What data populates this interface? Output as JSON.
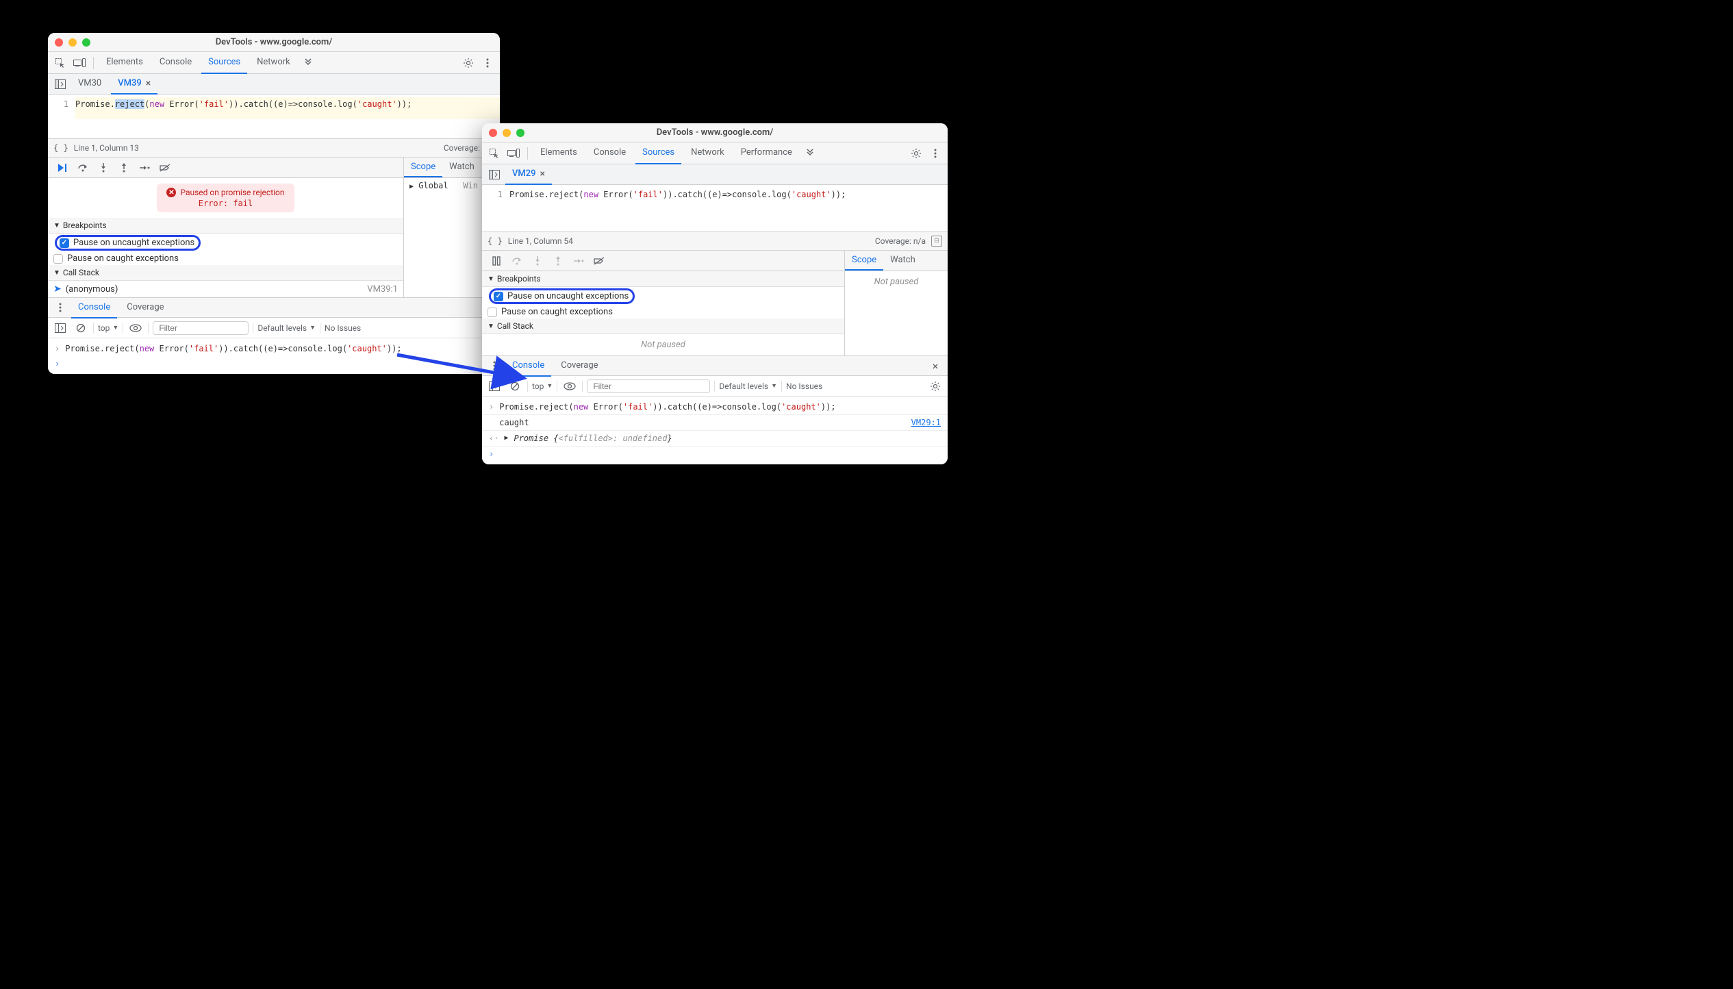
{
  "left_window": {
    "title": "DevTools - www.google.com/",
    "panel_tabs": [
      "Elements",
      "Console",
      "Sources",
      "Network"
    ],
    "active_panel": "Sources",
    "file_tabs": [
      {
        "name": "VM30",
        "active": false
      },
      {
        "name": "VM39",
        "active": true
      }
    ],
    "code": {
      "line_num": "1",
      "pre": "Promise.",
      "selected": "reject",
      "post1": "(",
      "kw": "new",
      "post2": " Error(",
      "str1": "'fail'",
      "post3": ")).catch((e)=>console.log(",
      "str2": "'caught'",
      "post4": "));"
    },
    "status": {
      "left": "Line 1, Column 13",
      "right": "Coverage: n/a"
    },
    "pause_banner": {
      "line1": "Paused on promise rejection",
      "line2": "Error: fail"
    },
    "breakpoints_label": "Breakpoints",
    "bp_uncaught": "Pause on uncaught exceptions",
    "bp_caught": "Pause on caught exceptions",
    "callstack_label": "Call Stack",
    "callstack": {
      "name": "(anonymous)",
      "loc": "VM39:1"
    },
    "scope_tab": "Scope",
    "watch_tab": "Watch",
    "scope_global": "Global",
    "scope_win": "Win",
    "drawer_tabs": [
      "Console",
      "Coverage"
    ],
    "console_toolbar": {
      "context": "top",
      "filter_placeholder": "Filter",
      "levels": "Default levels",
      "issues": "No Issues"
    },
    "console_input": "Promise.reject(new Error('fail')).catch((e)=>console.log('caught'));"
  },
  "right_window": {
    "title": "DevTools - www.google.com/",
    "panel_tabs": [
      "Elements",
      "Console",
      "Sources",
      "Network",
      "Performance"
    ],
    "active_panel": "Sources",
    "file_tabs": [
      {
        "name": "VM29",
        "active": true
      }
    ],
    "code": {
      "line_num": "1",
      "pre": "Promise.reject(",
      "kw": "new",
      "post2": " Error(",
      "str1": "'fail'",
      "post3": ")).catch((e)=>console.log(",
      "str2": "'caught'",
      "post4": "));"
    },
    "status": {
      "left": "Line 1, Column 54",
      "right": "Coverage: n/a"
    },
    "breakpoints_label": "Breakpoints",
    "bp_uncaught": "Pause on uncaught exceptions",
    "bp_caught": "Pause on caught exceptions",
    "callstack_label": "Call Stack",
    "not_paused": "Not paused",
    "scope_tab": "Scope",
    "watch_tab": "Watch",
    "scope_not_paused": "Not paused",
    "drawer_tabs": [
      "Console",
      "Coverage"
    ],
    "console_toolbar": {
      "context": "top",
      "filter_placeholder": "Filter",
      "levels": "Default levels",
      "issues": "No Issues"
    },
    "console_lines": {
      "in1": "Promise.reject(new Error('fail')).catch((e)=>console.log('caught'));",
      "log": "caught",
      "log_link": "VM29:1",
      "ret_pre": "Promise {",
      "ret_status": "<fulfilled>",
      "ret_val": ": undefined",
      "ret_post": "}"
    }
  }
}
